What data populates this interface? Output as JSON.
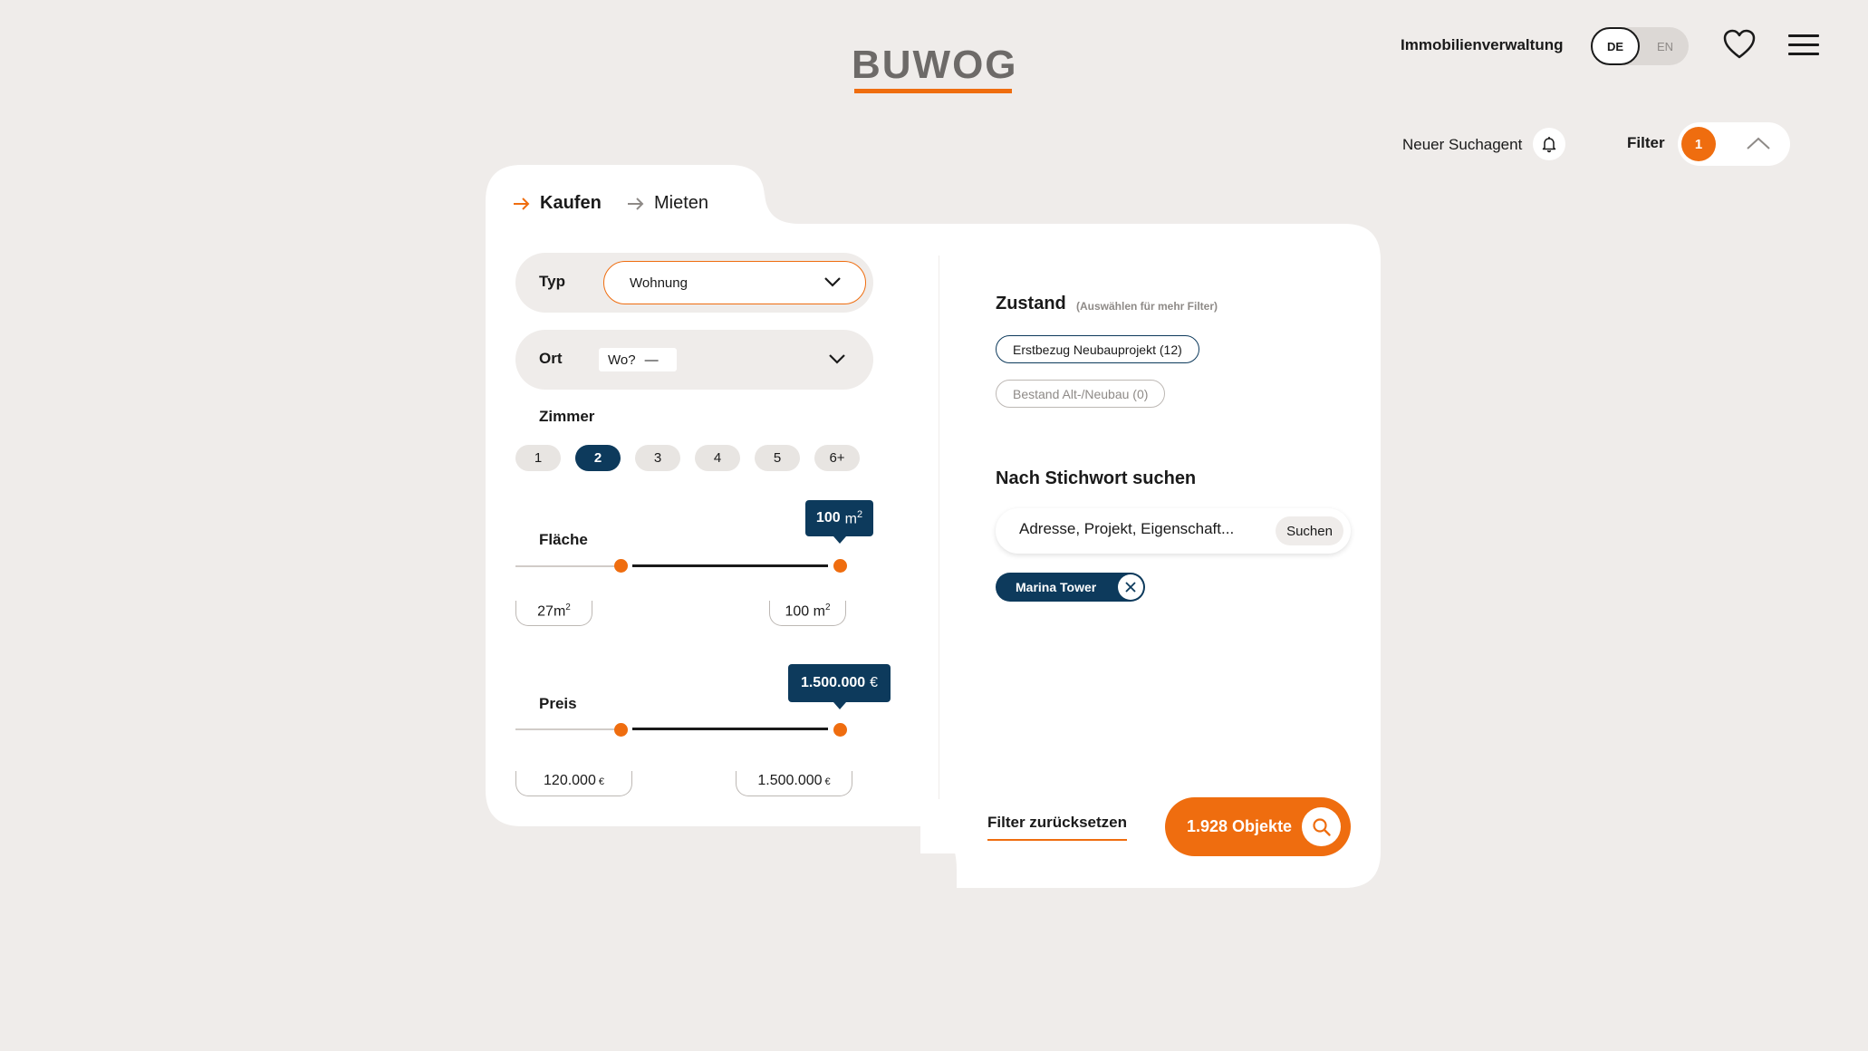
{
  "header": {
    "logo": "BUWOG",
    "nav_link": "Immobilienverwaltung",
    "lang_active": "DE",
    "lang_inactive": "EN"
  },
  "toolbar": {
    "search_agent_label": "Neuer Suchagent",
    "filter_label": "Filter",
    "filter_count": "1"
  },
  "tabs": {
    "buy": "Kaufen",
    "rent": "Mieten"
  },
  "typ": {
    "label": "Typ",
    "value": "Wohnung"
  },
  "ort": {
    "label": "Ort",
    "placeholder": "Wo?",
    "dash": "—"
  },
  "zimmer": {
    "label": "Zimmer",
    "options": [
      "1",
      "2",
      "3",
      "4",
      "5",
      "6+"
    ],
    "selected": "2"
  },
  "flaeche": {
    "label": "Fläche",
    "min": "27",
    "max": "100",
    "unit": "m",
    "unit_sup": "2",
    "tooltip": "100"
  },
  "preis": {
    "label": "Preis",
    "min": "120.000",
    "max": "1.500.000",
    "currency": "€",
    "tooltip": "1.500.000"
  },
  "zustand": {
    "title": "Zustand",
    "hint": "(Auswählen für mehr Filter)",
    "chip_1": "Erstbezug Neubauprojekt (12)",
    "chip_2": "Bestand Alt-/Neubau (0)"
  },
  "keyword": {
    "title": "Nach Stichwort suchen",
    "input_value": "Adresse, Projekt, Eigenschaft...",
    "search_button": "Suchen",
    "tag": "Marina Tower"
  },
  "footer": {
    "reset": "Filter zurücksetzen",
    "results": "1.928 Objekte"
  },
  "colors": {
    "accent": "#ef6d0f",
    "navy": "#0d3a5c",
    "background": "#efecea"
  }
}
